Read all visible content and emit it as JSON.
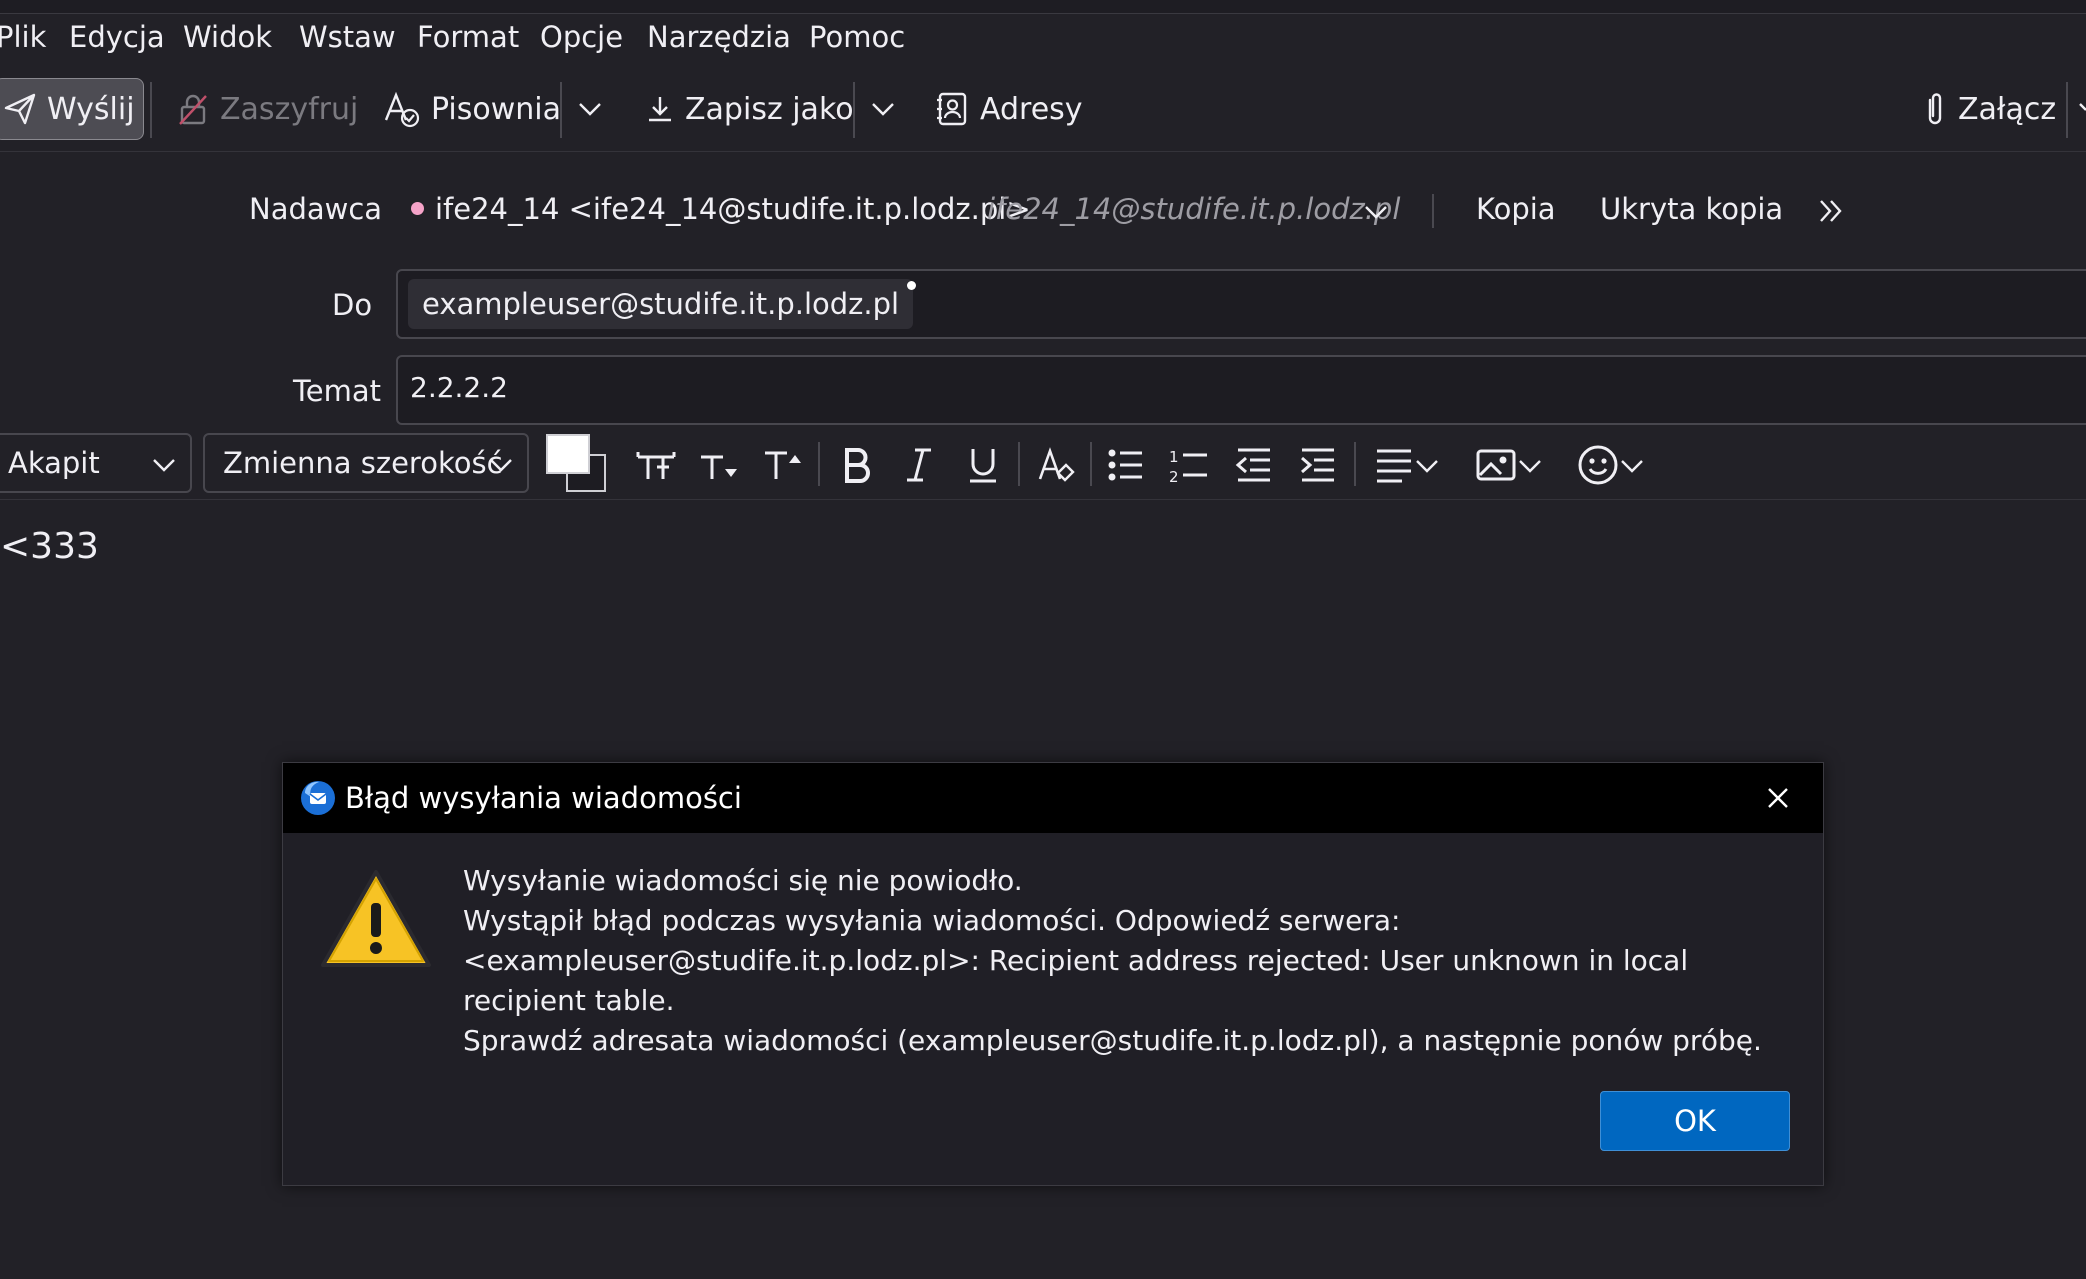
{
  "menubar": {
    "items": [
      "Plik",
      "Edycja",
      "Widok",
      "Wstaw",
      "Format",
      "Opcje",
      "Narzędzia",
      "Pomoc"
    ]
  },
  "toolbar": {
    "send_label": "Wyślij",
    "encrypt_label": "Zaszyfruj",
    "spelling_label": "Pisownia",
    "save_as_label": "Zapisz jako",
    "addresses_label": "Adresy",
    "attach_label": "Załącz"
  },
  "header": {
    "sender_label": "Nadawca",
    "sender_value": "ife24_14 <ife24_14@studife.it.p.lodz.pl>",
    "sender_alt": "ife24_14@studife.it.p.lodz.pl",
    "cc_label": "Kopia",
    "bcc_label": "Ukryta kopia",
    "to_label": "Do",
    "to_recipient": "exampleuser@studife.it.p.lodz.pl",
    "subject_label": "Temat",
    "subject_value": "2.2.2.2"
  },
  "format_bar": {
    "paragraph_select": "Akapit",
    "font_select": "Zmienna szerokość"
  },
  "body": {
    "text": "<333"
  },
  "dialog": {
    "title": "Błąd wysyłania wiadomości",
    "line1": "Wysyłanie wiadomości się nie powiodło.",
    "line2": "Wystąpił błąd podczas wysyłania wiadomości. Odpowiedź serwera:",
    "line3": "<exampleuser@studife.it.p.lodz.pl>: Recipient address rejected: User unknown in local recipient table.",
    "line4": "Sprawdź adresata wiadomości (exampleuser@studife.it.p.lodz.pl), a następnie ponów próbę.",
    "ok_label": "OK"
  },
  "colors": {
    "background": "#222127",
    "accent": "#0067c0",
    "warning": "#f7c325"
  }
}
